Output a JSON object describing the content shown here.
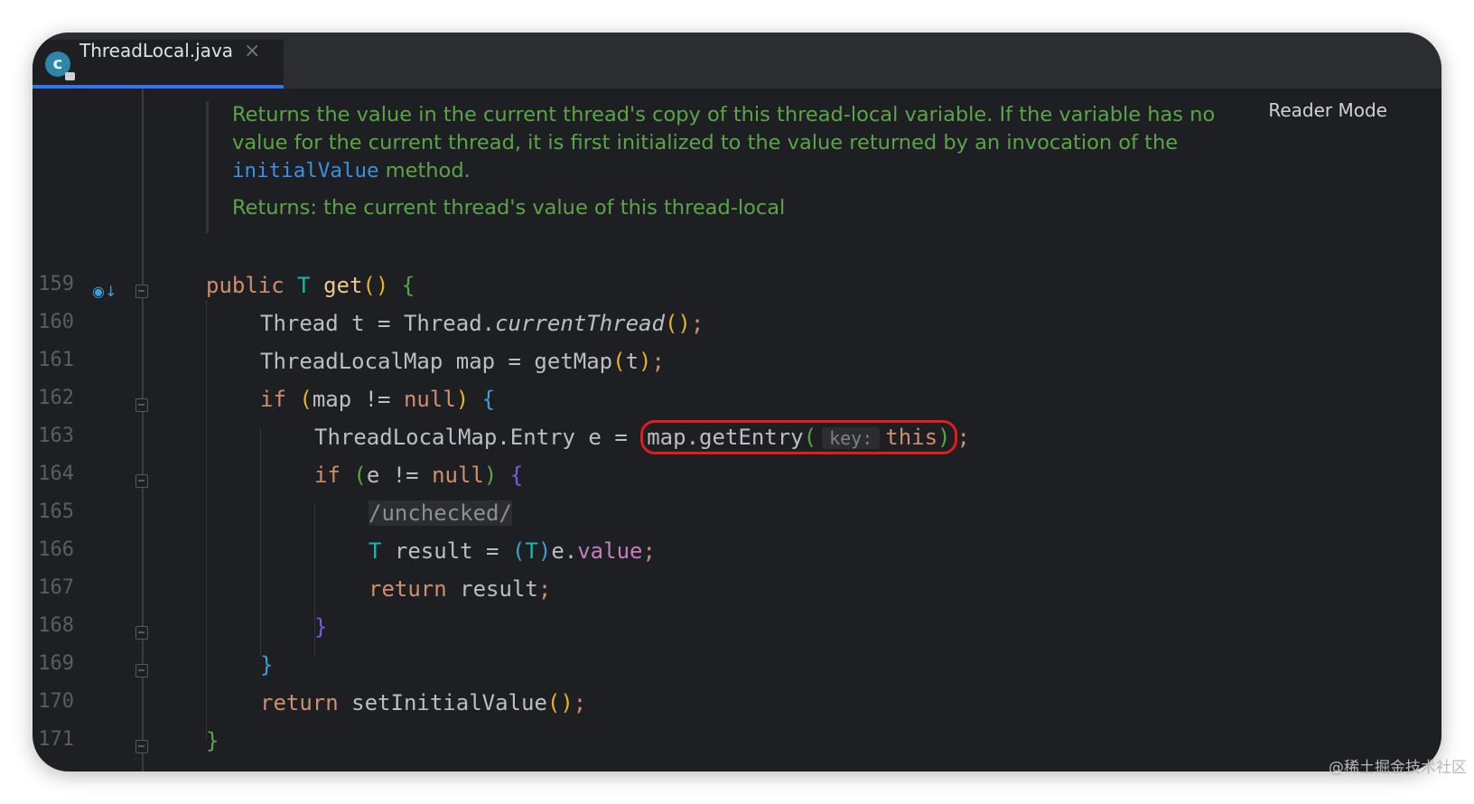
{
  "tab": {
    "filename": "ThreadLocal.java",
    "icon": "java-class-icon",
    "close": "×"
  },
  "reader_mode": "Reader Mode",
  "doc": {
    "line1": "Returns the value in the current thread's copy of this thread-local variable. If the variable has no",
    "line2": "value for the current thread, it is first initialized to the value returned by an invocation of the",
    "link": "initialValue",
    "after_link": " method.",
    "returns": "Returns: the current thread's value of this thread-local"
  },
  "lines": [
    {
      "n": "159"
    },
    {
      "n": "160"
    },
    {
      "n": "161"
    },
    {
      "n": "162"
    },
    {
      "n": "163"
    },
    {
      "n": "164"
    },
    {
      "n": "165"
    },
    {
      "n": "166"
    },
    {
      "n": "167"
    },
    {
      "n": "168"
    },
    {
      "n": "169"
    },
    {
      "n": "170"
    },
    {
      "n": "171"
    }
  ],
  "code": {
    "l159": {
      "kw": "public",
      "type": "T",
      "fn": "get",
      "p": "()",
      "b": "{"
    },
    "l160": {
      "a": "Thread t = Thread.",
      "it": "currentThread",
      "p": "()",
      "s": ";"
    },
    "l161": {
      "a": "ThreadLocalMap map = getMap",
      "p1": "(",
      "arg": "t",
      "p2": ")",
      "s": ";"
    },
    "l162": {
      "kw": "if",
      "p1": "(",
      "a": "map != ",
      "nl": "null",
      "p2": ")",
      "b": "{"
    },
    "l163": {
      "a": "ThreadLocalMap.Entry e = ",
      "call": "map.getEntry",
      "p1": "(",
      "hint": "key:",
      "this": "this",
      "p2": ")",
      "s": ";"
    },
    "l164": {
      "kw": "if",
      "p1": "(",
      "a": "e != ",
      "nl": "null",
      "p2": ")",
      "b": "{"
    },
    "l165": {
      "cmt": "/unchecked/"
    },
    "l166": {
      "type": "T",
      "a": " result = ",
      "p1": "(",
      "cast": "T",
      "p2": ")",
      "e": "e.",
      "fld": "value",
      "s": ";"
    },
    "l167": {
      "kw": "return",
      "a": " result",
      "s": ";"
    },
    "l168": {
      "b": "}"
    },
    "l169": {
      "b": "}"
    },
    "l170": {
      "kw": "return",
      "a": " setInitialValue",
      "p": "()",
      "s": ";"
    },
    "l171": {
      "b": "}"
    }
  },
  "watermark": "@稀土掘金技术社区",
  "colors": {
    "background": "#1e1f22",
    "keyword": "#cf8e6d",
    "doc": "#5ba448",
    "highlight": "#e11c1c",
    "tab_accent": "#3574f0"
  }
}
